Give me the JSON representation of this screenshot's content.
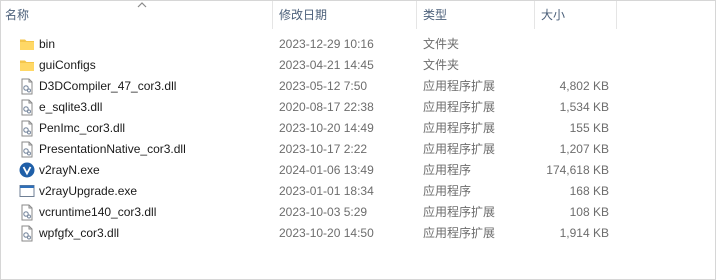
{
  "columns": {
    "name": "名称",
    "date": "修改日期",
    "type": "类型",
    "size": "大小"
  },
  "files": [
    {
      "name": "bin",
      "date": "2023-12-29  10:16",
      "type": "文件夹",
      "size": "",
      "icon": "folder-icon"
    },
    {
      "name": "guiConfigs",
      "date": "2023-04-21  14:45",
      "type": "文件夹",
      "size": "",
      "icon": "folder-icon"
    },
    {
      "name": "D3DCompiler_47_cor3.dll",
      "date": "2023-05-12  7:50",
      "type": "应用程序扩展",
      "size": "4,802 KB",
      "icon": "dll-file-icon"
    },
    {
      "name": "e_sqlite3.dll",
      "date": "2020-08-17  22:38",
      "type": "应用程序扩展",
      "size": "1,534 KB",
      "icon": "dll-file-icon"
    },
    {
      "name": "PenImc_cor3.dll",
      "date": "2023-10-20  14:49",
      "type": "应用程序扩展",
      "size": "155 KB",
      "icon": "dll-file-icon"
    },
    {
      "name": "PresentationNative_cor3.dll",
      "date": "2023-10-17  2:22",
      "type": "应用程序扩展",
      "size": "1,207 KB",
      "icon": "dll-file-icon"
    },
    {
      "name": "v2rayN.exe",
      "date": "2024-01-06  13:49",
      "type": "应用程序",
      "size": "174,618 KB",
      "icon": "v2rayn-app-icon"
    },
    {
      "name": "v2rayUpgrade.exe",
      "date": "2023-01-01  18:34",
      "type": "应用程序",
      "size": "168 KB",
      "icon": "exe-window-icon"
    },
    {
      "name": "vcruntime140_cor3.dll",
      "date": "2023-10-03  5:29",
      "type": "应用程序扩展",
      "size": "108 KB",
      "icon": "dll-file-icon"
    },
    {
      "name": "wpfgfx_cor3.dll",
      "date": "2023-10-20  14:50",
      "type": "应用程序扩展",
      "size": "1,914 KB",
      "icon": "dll-file-icon"
    }
  ],
  "colors": {
    "folder": "#f4c64c",
    "header_text": "#4c607a",
    "meta_text": "#6d6d6d",
    "v2rayn": "#1f5fa8"
  }
}
